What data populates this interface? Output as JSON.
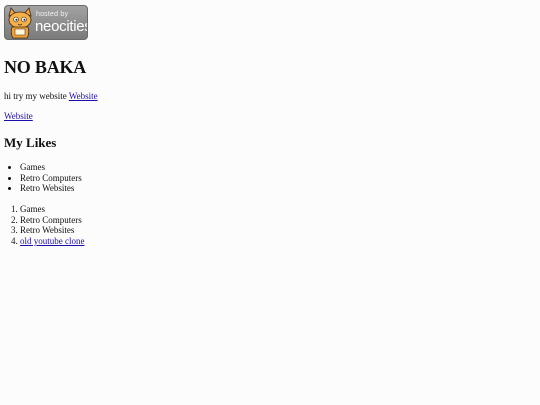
{
  "badge": {
    "small_text": "hosted by",
    "big_text": "neocities"
  },
  "heading": "NO BAKA",
  "intro": {
    "text": "hi try my website ",
    "link_label": "Website"
  },
  "standalone_link": "Website",
  "likes_heading": "My Likes",
  "likes_bullets": [
    "Games",
    "Retro Computers",
    "Retro Websites"
  ],
  "likes_numbered": {
    "items": [
      "Games",
      "Retro Computers",
      "Retro Websites"
    ],
    "link_item": "old youtube clone"
  }
}
